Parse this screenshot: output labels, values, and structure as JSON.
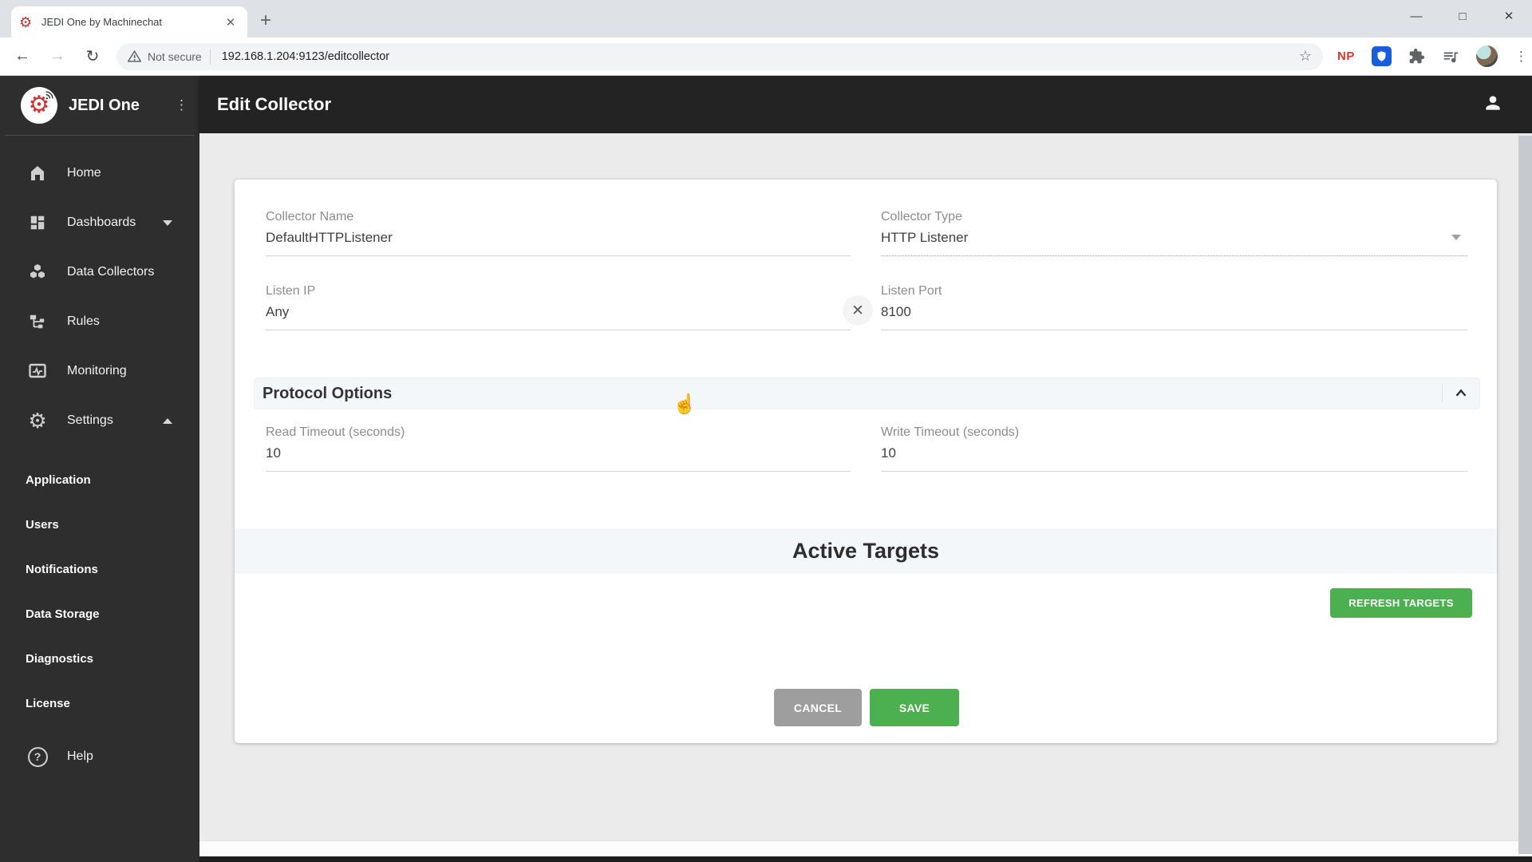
{
  "browser": {
    "tab_title": "JEDI One by Machinechat",
    "security_label": "Not secure",
    "url": "192.168.1.204:9123/editcollector",
    "np_badge": "NP"
  },
  "sidebar": {
    "brand": "JEDI One",
    "nav": [
      {
        "label": "Home"
      },
      {
        "label": "Dashboards"
      },
      {
        "label": "Data Collectors"
      },
      {
        "label": "Rules"
      },
      {
        "label": "Monitoring"
      },
      {
        "label": "Settings"
      }
    ],
    "settings_children": [
      {
        "label": "Application"
      },
      {
        "label": "Users"
      },
      {
        "label": "Notifications"
      },
      {
        "label": "Data Storage"
      },
      {
        "label": "Diagnostics"
      },
      {
        "label": "License"
      }
    ],
    "help_label": "Help"
  },
  "header": {
    "title": "Edit Collector"
  },
  "form": {
    "collector_name": {
      "label": "Collector Name",
      "value": "DefaultHTTPListener"
    },
    "collector_type": {
      "label": "Collector Type",
      "value": "HTTP Listener"
    },
    "listen_ip": {
      "label": "Listen IP",
      "value": "Any"
    },
    "listen_port": {
      "label": "Listen Port",
      "value": "8100"
    },
    "protocol_options_title": "Protocol Options",
    "read_timeout": {
      "label": "Read Timeout (seconds)",
      "value": "10"
    },
    "write_timeout": {
      "label": "Write Timeout (seconds)",
      "value": "10"
    }
  },
  "targets": {
    "title": "Active Targets",
    "refresh_button": "REFRESH TARGETS"
  },
  "actions": {
    "cancel": "CANCEL",
    "save": "SAVE"
  },
  "colors": {
    "accent_green": "#4caf50",
    "cancel_gray": "#9e9e9e",
    "brand_red": "#d32f2f"
  }
}
